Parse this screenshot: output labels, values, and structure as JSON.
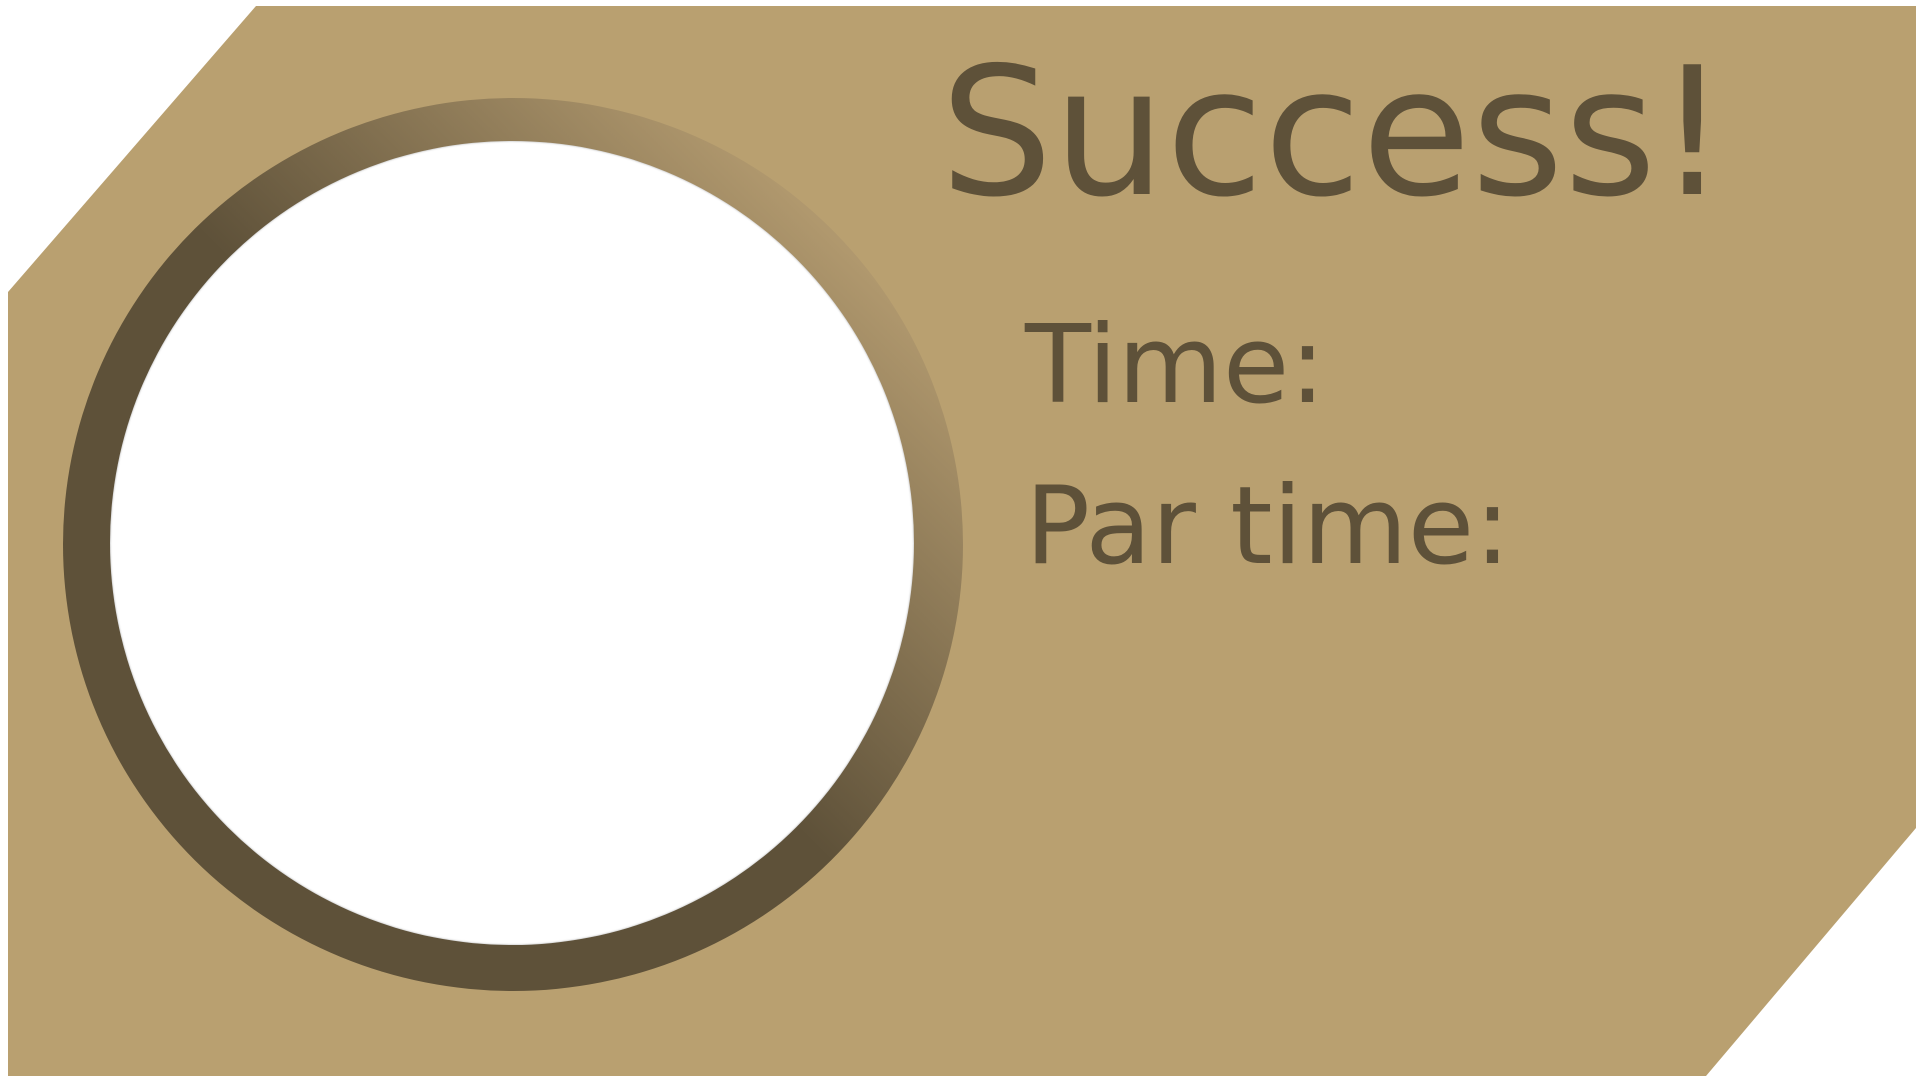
{
  "colors": {
    "panel": "#b9a070",
    "text": "#5e5139",
    "ring_dark": "#5e5139",
    "ring_light": "#bba16f",
    "portrait": "#ffffff"
  },
  "results": {
    "title": "Success!",
    "time_label": "Time:",
    "par_time_label": "Par time:"
  }
}
